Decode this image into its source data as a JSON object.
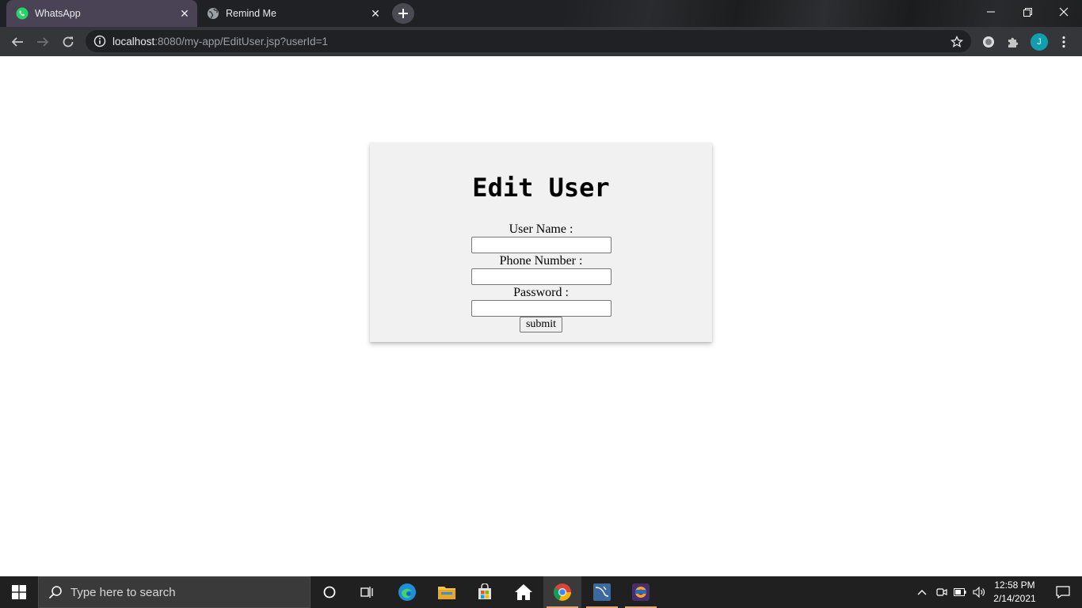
{
  "browser": {
    "tabs": [
      {
        "title": "WhatsApp",
        "active": true,
        "icon": "whatsapp-icon"
      },
      {
        "title": "Remind Me",
        "active": false,
        "icon": "globe-icon"
      }
    ],
    "url": {
      "host": "localhost",
      "rest": ":8080/my-app/EditUser.jsp?userId=1"
    },
    "profile_initial": "J"
  },
  "page": {
    "title": "Edit User",
    "fields": [
      {
        "label": "User Name :",
        "value": ""
      },
      {
        "label": "Phone Number :",
        "value": ""
      },
      {
        "label": "Password :",
        "value": ""
      }
    ],
    "submit_label": "submit"
  },
  "taskbar": {
    "search_placeholder": "Type here to search",
    "time": "12:58 PM",
    "date": "2/14/2021"
  },
  "colors": {
    "card_bg": "#f1f1f1",
    "active_tab": "#4a4356",
    "avatar": "#129eaf",
    "taskbar": "#202020"
  }
}
